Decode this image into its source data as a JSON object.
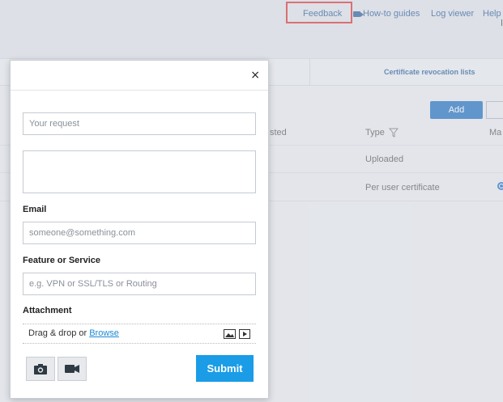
{
  "header": {
    "links": {
      "feedback": "Feedback",
      "howto": "How-to guides",
      "logviewer": "Log viewer",
      "help": "Help"
    }
  },
  "tabs": {
    "crl": "Certificate revocation lists"
  },
  "toolbar": {
    "add_label": "Add"
  },
  "table": {
    "columns": {
      "sted": "sted",
      "type": "Type",
      "ma": "Ma"
    },
    "rows": [
      {
        "type": "Uploaded"
      },
      {
        "type": "Per user certificate"
      }
    ]
  },
  "modal": {
    "close": "×",
    "request_placeholder": "Your request",
    "email_label": "Email",
    "email_placeholder": "someone@something.com",
    "feature_label": "Feature or Service",
    "feature_placeholder": "e.g. VPN or SSL/TLS or Routing",
    "attachment_label": "Attachment",
    "drag_text": "Drag & drop or ",
    "browse_label": "Browse",
    "submit_label": "Submit"
  },
  "colors": {
    "accent": "#1a9ce6",
    "primary": "#1f6fbf",
    "highlight": "#d9353a"
  }
}
